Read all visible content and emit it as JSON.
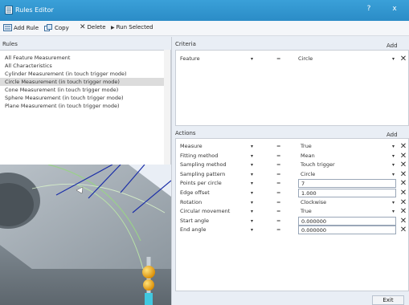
{
  "window": {
    "title": "Rules Editor",
    "help_glyph": "?",
    "close_glyph": "x"
  },
  "toolbar": {
    "add_rule": "Add Rule",
    "copy": "Copy",
    "delete": "Delete",
    "run_selected": "Run Selected"
  },
  "rules": {
    "header": "Rules",
    "items": [
      {
        "label": "All Feature Measurement"
      },
      {
        "label": "All Characteristics"
      },
      {
        "label": "Cylinder Measurement (in touch trigger mode)"
      },
      {
        "label": "Circle Measurement (in touch trigger mode)"
      },
      {
        "label": "Cone Measurement (in touch trigger mode)"
      },
      {
        "label": "Sphere Measurement (in touch trigger mode)"
      },
      {
        "label": "Plane Measurement (in touch trigger mode)"
      }
    ],
    "selected_index": 3
  },
  "criteria": {
    "header": "Criteria",
    "add_label": "Add",
    "rows": [
      {
        "name": "Feature",
        "operator": "=",
        "value": "Circle"
      }
    ]
  },
  "actions": {
    "header": "Actions",
    "add_label": "Add",
    "rows": [
      {
        "name": "Measure",
        "operator": "=",
        "value": "True",
        "kind": "dropdown"
      },
      {
        "name": "Fitting method",
        "operator": "=",
        "value": "Mean",
        "kind": "dropdown"
      },
      {
        "name": "Sampling method",
        "operator": "=",
        "value": "Touch trigger",
        "kind": "dropdown"
      },
      {
        "name": "Sampling pattern",
        "operator": "=",
        "value": "Circle",
        "kind": "dropdown"
      },
      {
        "name": "Points per circle",
        "operator": "=",
        "value": "7",
        "kind": "input"
      },
      {
        "name": "Edge offset",
        "operator": "=",
        "value": "1.000",
        "kind": "input"
      },
      {
        "name": "Rotation",
        "operator": "=",
        "value": "Clockwise",
        "kind": "dropdown"
      },
      {
        "name": "Circular movement",
        "operator": "=",
        "value": "True",
        "kind": "dropdown"
      },
      {
        "name": "Start angle",
        "operator": "=",
        "value": "0.000000",
        "kind": "input"
      },
      {
        "name": "End angle",
        "operator": "=",
        "value": "0.000000",
        "kind": "input"
      }
    ]
  },
  "footer": {
    "exit": "Exit"
  },
  "colors": {
    "titlebar": "#2b8cc7",
    "selection": "#dcdcdc",
    "probe": "#f0a800"
  }
}
